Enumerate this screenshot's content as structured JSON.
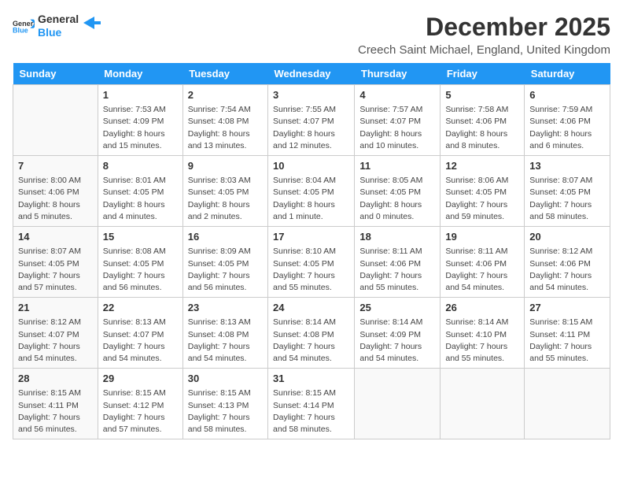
{
  "header": {
    "logo_general": "General",
    "logo_blue": "Blue",
    "month_title": "December 2025",
    "subtitle": "Creech Saint Michael, England, United Kingdom"
  },
  "weekdays": [
    "Sunday",
    "Monday",
    "Tuesday",
    "Wednesday",
    "Thursday",
    "Friday",
    "Saturday"
  ],
  "weeks": [
    [
      {
        "day": "",
        "sunrise": "",
        "sunset": "",
        "daylight": ""
      },
      {
        "day": "1",
        "sunrise": "Sunrise: 7:53 AM",
        "sunset": "Sunset: 4:09 PM",
        "daylight": "Daylight: 8 hours and 15 minutes."
      },
      {
        "day": "2",
        "sunrise": "Sunrise: 7:54 AM",
        "sunset": "Sunset: 4:08 PM",
        "daylight": "Daylight: 8 hours and 13 minutes."
      },
      {
        "day": "3",
        "sunrise": "Sunrise: 7:55 AM",
        "sunset": "Sunset: 4:07 PM",
        "daylight": "Daylight: 8 hours and 12 minutes."
      },
      {
        "day": "4",
        "sunrise": "Sunrise: 7:57 AM",
        "sunset": "Sunset: 4:07 PM",
        "daylight": "Daylight: 8 hours and 10 minutes."
      },
      {
        "day": "5",
        "sunrise": "Sunrise: 7:58 AM",
        "sunset": "Sunset: 4:06 PM",
        "daylight": "Daylight: 8 hours and 8 minutes."
      },
      {
        "day": "6",
        "sunrise": "Sunrise: 7:59 AM",
        "sunset": "Sunset: 4:06 PM",
        "daylight": "Daylight: 8 hours and 6 minutes."
      }
    ],
    [
      {
        "day": "7",
        "sunrise": "Sunrise: 8:00 AM",
        "sunset": "Sunset: 4:06 PM",
        "daylight": "Daylight: 8 hours and 5 minutes."
      },
      {
        "day": "8",
        "sunrise": "Sunrise: 8:01 AM",
        "sunset": "Sunset: 4:05 PM",
        "daylight": "Daylight: 8 hours and 4 minutes."
      },
      {
        "day": "9",
        "sunrise": "Sunrise: 8:03 AM",
        "sunset": "Sunset: 4:05 PM",
        "daylight": "Daylight: 8 hours and 2 minutes."
      },
      {
        "day": "10",
        "sunrise": "Sunrise: 8:04 AM",
        "sunset": "Sunset: 4:05 PM",
        "daylight": "Daylight: 8 hours and 1 minute."
      },
      {
        "day": "11",
        "sunrise": "Sunrise: 8:05 AM",
        "sunset": "Sunset: 4:05 PM",
        "daylight": "Daylight: 8 hours and 0 minutes."
      },
      {
        "day": "12",
        "sunrise": "Sunrise: 8:06 AM",
        "sunset": "Sunset: 4:05 PM",
        "daylight": "Daylight: 7 hours and 59 minutes."
      },
      {
        "day": "13",
        "sunrise": "Sunrise: 8:07 AM",
        "sunset": "Sunset: 4:05 PM",
        "daylight": "Daylight: 7 hours and 58 minutes."
      }
    ],
    [
      {
        "day": "14",
        "sunrise": "Sunrise: 8:07 AM",
        "sunset": "Sunset: 4:05 PM",
        "daylight": "Daylight: 7 hours and 57 minutes."
      },
      {
        "day": "15",
        "sunrise": "Sunrise: 8:08 AM",
        "sunset": "Sunset: 4:05 PM",
        "daylight": "Daylight: 7 hours and 56 minutes."
      },
      {
        "day": "16",
        "sunrise": "Sunrise: 8:09 AM",
        "sunset": "Sunset: 4:05 PM",
        "daylight": "Daylight: 7 hours and 56 minutes."
      },
      {
        "day": "17",
        "sunrise": "Sunrise: 8:10 AM",
        "sunset": "Sunset: 4:05 PM",
        "daylight": "Daylight: 7 hours and 55 minutes."
      },
      {
        "day": "18",
        "sunrise": "Sunrise: 8:11 AM",
        "sunset": "Sunset: 4:06 PM",
        "daylight": "Daylight: 7 hours and 55 minutes."
      },
      {
        "day": "19",
        "sunrise": "Sunrise: 8:11 AM",
        "sunset": "Sunset: 4:06 PM",
        "daylight": "Daylight: 7 hours and 54 minutes."
      },
      {
        "day": "20",
        "sunrise": "Sunrise: 8:12 AM",
        "sunset": "Sunset: 4:06 PM",
        "daylight": "Daylight: 7 hours and 54 minutes."
      }
    ],
    [
      {
        "day": "21",
        "sunrise": "Sunrise: 8:12 AM",
        "sunset": "Sunset: 4:07 PM",
        "daylight": "Daylight: 7 hours and 54 minutes."
      },
      {
        "day": "22",
        "sunrise": "Sunrise: 8:13 AM",
        "sunset": "Sunset: 4:07 PM",
        "daylight": "Daylight: 7 hours and 54 minutes."
      },
      {
        "day": "23",
        "sunrise": "Sunrise: 8:13 AM",
        "sunset": "Sunset: 4:08 PM",
        "daylight": "Daylight: 7 hours and 54 minutes."
      },
      {
        "day": "24",
        "sunrise": "Sunrise: 8:14 AM",
        "sunset": "Sunset: 4:08 PM",
        "daylight": "Daylight: 7 hours and 54 minutes."
      },
      {
        "day": "25",
        "sunrise": "Sunrise: 8:14 AM",
        "sunset": "Sunset: 4:09 PM",
        "daylight": "Daylight: 7 hours and 54 minutes."
      },
      {
        "day": "26",
        "sunrise": "Sunrise: 8:14 AM",
        "sunset": "Sunset: 4:10 PM",
        "daylight": "Daylight: 7 hours and 55 minutes."
      },
      {
        "day": "27",
        "sunrise": "Sunrise: 8:15 AM",
        "sunset": "Sunset: 4:11 PM",
        "daylight": "Daylight: 7 hours and 55 minutes."
      }
    ],
    [
      {
        "day": "28",
        "sunrise": "Sunrise: 8:15 AM",
        "sunset": "Sunset: 4:11 PM",
        "daylight": "Daylight: 7 hours and 56 minutes."
      },
      {
        "day": "29",
        "sunrise": "Sunrise: 8:15 AM",
        "sunset": "Sunset: 4:12 PM",
        "daylight": "Daylight: 7 hours and 57 minutes."
      },
      {
        "day": "30",
        "sunrise": "Sunrise: 8:15 AM",
        "sunset": "Sunset: 4:13 PM",
        "daylight": "Daylight: 7 hours and 58 minutes."
      },
      {
        "day": "31",
        "sunrise": "Sunrise: 8:15 AM",
        "sunset": "Sunset: 4:14 PM",
        "daylight": "Daylight: 7 hours and 58 minutes."
      },
      {
        "day": "",
        "sunrise": "",
        "sunset": "",
        "daylight": ""
      },
      {
        "day": "",
        "sunrise": "",
        "sunset": "",
        "daylight": ""
      },
      {
        "day": "",
        "sunrise": "",
        "sunset": "",
        "daylight": ""
      }
    ]
  ]
}
